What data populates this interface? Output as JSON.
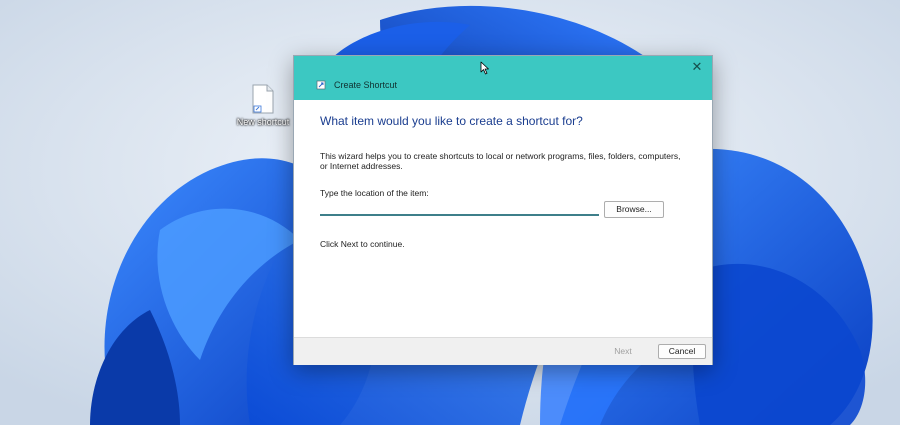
{
  "desktop": {
    "icon_label": "New shortcut"
  },
  "dialog": {
    "title": "Create Shortcut",
    "close_glyph": "✕",
    "heading": "What item would you like to create a shortcut for?",
    "description": "This wizard helps you to create shortcuts to local or network programs, files, folders, computers, or Internet addresses.",
    "location_label": "Type the location of the item:",
    "location_value": "",
    "location_placeholder": "",
    "browse_label": "Browse...",
    "continue_text": "Click Next to continue.",
    "next_label": "Next",
    "cancel_label": "Cancel"
  },
  "colors": {
    "titlebar": "#3cc8c2",
    "heading": "#1a3d8f",
    "wallpaper_blue": "#1a5fe0"
  },
  "icons": {
    "desktop_item": "file-icon",
    "title": "shortcut-icon",
    "close": "close-icon",
    "pointer": "mouse-cursor-icon"
  }
}
